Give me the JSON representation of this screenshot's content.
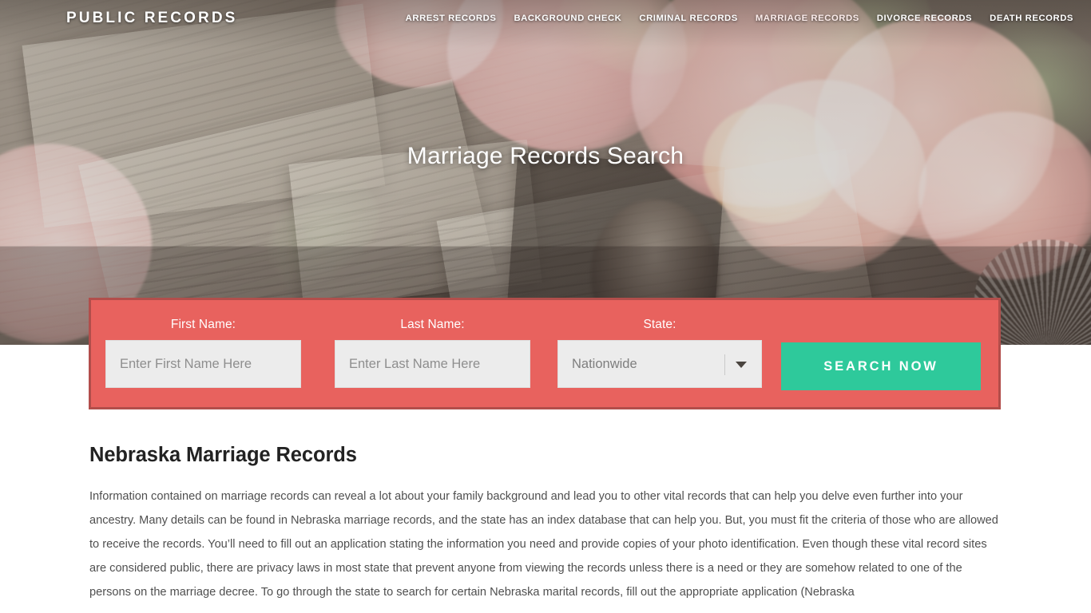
{
  "site": {
    "brand": "PUBLIC RECORDS"
  },
  "nav": {
    "items": [
      {
        "label": "ARREST RECORDS",
        "active": false
      },
      {
        "label": "BACKGROUND CHECK",
        "active": false
      },
      {
        "label": "CRIMINAL RECORDS",
        "active": false
      },
      {
        "label": "MARRIAGE RECORDS",
        "active": true
      },
      {
        "label": "DIVORCE RECORDS",
        "active": false
      },
      {
        "label": "DEATH RECORDS",
        "active": false
      }
    ]
  },
  "hero": {
    "title": "Marriage Records Search"
  },
  "search_form": {
    "first_name": {
      "label": "First Name:",
      "placeholder": "Enter First Name Here",
      "value": ""
    },
    "last_name": {
      "label": "Last Name:",
      "placeholder": "Enter Last Name Here",
      "value": ""
    },
    "state": {
      "label": "State:",
      "selected": "Nationwide",
      "options": [
        "Nationwide"
      ]
    },
    "submit_label": "SEARCH NOW"
  },
  "main": {
    "heading": "Nebraska Marriage Records",
    "paragraph": "Information contained on marriage records can reveal a lot about your family background and lead you to other vital records that can help you delve even further into your ancestry. Many details can be found in Nebraska marriage records, and the state has an index database that can help you. But, you must fit the criteria of those who are allowed to receive the records. You’ll need to fill out an application stating the information you need and provide copies of your photo identification. Even though these vital record sites are considered public, there are privacy laws in most state that prevent anyone from viewing the records unless there is a need or they are somehow related to one of the persons on the marriage decree. To go through the state to search for certain Nebraska marital records, fill out the appropriate application (Nebraska"
  },
  "colors": {
    "form_background": "#e8625e",
    "form_border": "#b24e4b",
    "submit_button": "#2ec99b",
    "input_background": "#ececec",
    "heading_text": "#222222",
    "body_text": "#4f4f4f",
    "nav_text": "#ffffff"
  },
  "icons": {
    "select_chevron": "chevron-down-icon"
  }
}
